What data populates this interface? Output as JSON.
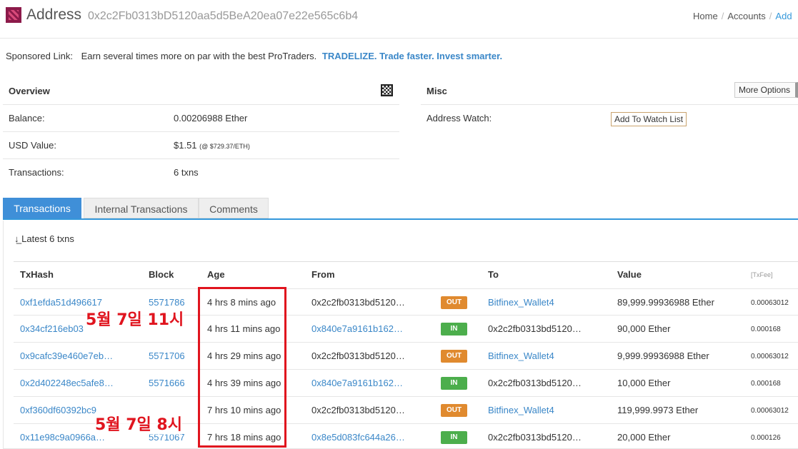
{
  "header": {
    "title": "Address",
    "address": "0x2c2Fb0313bD5120aa5d5BeA20ea07e22e565c6b4",
    "breadcrumb": [
      "Home",
      "Accounts",
      "Add"
    ]
  },
  "sponsored": {
    "label": "Sponsored Link:",
    "message": "Earn several times more on par with the best ProTraders.",
    "link_text": "TRADELIZE. Trade faster. Invest smarter."
  },
  "overview": {
    "title": "Overview",
    "balance_label": "Balance:",
    "balance_value": "0.00206988 Ether",
    "usd_label": "USD Value:",
    "usd_value": "$1.51",
    "usd_rate": "(@ $729.37/ETH)",
    "tx_label": "Transactions:",
    "tx_value": "6 txns"
  },
  "misc": {
    "title": "Misc",
    "more_options": "More Options",
    "watch_label": "Address Watch:",
    "watch_button": "Add To Watch List"
  },
  "tabs": [
    "Transactions",
    "Internal Transactions",
    "Comments"
  ],
  "latest_label": "Latest 6 txns",
  "latest_icon": "sort-desc-icon",
  "columns": [
    "TxHash",
    "Block",
    "Age",
    "From",
    "To",
    "Value",
    "[TxFee]"
  ],
  "rows": [
    {
      "hash": "0xf1efda51d496617",
      "block": "5571786",
      "age": "4 hrs 8 mins ago",
      "from": "0x2c2fb0313bd5120…",
      "dir": "OUT",
      "to": "Bitfinex_Wallet4",
      "value": "89,999.99936988 Ether",
      "fee": "0.00063012"
    },
    {
      "hash": "0x34cf216eb03",
      "block": "",
      "age": "4 hrs 11 mins ago",
      "from": "0x840e7a9161b162…",
      "dir": "IN",
      "to": "0x2c2fb0313bd5120…",
      "value": "90,000 Ether",
      "fee": "0.000168"
    },
    {
      "hash": "0x9cafc39e460e7eb…",
      "block": "5571706",
      "age": "4 hrs 29 mins ago",
      "from": "0x2c2fb0313bd5120…",
      "dir": "OUT",
      "to": "Bitfinex_Wallet4",
      "value": "9,999.99936988 Ether",
      "fee": "0.00063012"
    },
    {
      "hash": "0x2d402248ec5afe8…",
      "block": "5571666",
      "age": "4 hrs 39 mins ago",
      "from": "0x840e7a9161b162…",
      "dir": "IN",
      "to": "0x2c2fb0313bd5120…",
      "value": "10,000 Ether",
      "fee": "0.000168"
    },
    {
      "hash": "0xf360df60392bc9",
      "block": "",
      "age": "7 hrs 10 mins ago",
      "from": "0x2c2fb0313bd5120…",
      "dir": "OUT",
      "to": "Bitfinex_Wallet4",
      "value": "119,999.9973 Ether",
      "fee": "0.00063012"
    },
    {
      "hash": "0x11e98c9a0966a…",
      "block": "5571067",
      "age": "7 hrs 18 mins ago",
      "from": "0x8e5d083fc644a26…",
      "dir": "IN",
      "to": "0x2c2fb0313bd5120…",
      "value": "20,000 Ether",
      "fee": "0.000126"
    }
  ],
  "annotations": [
    "5월 7일 11시",
    "5월 7일 8시"
  ],
  "colors": {
    "annotation": "#e0141e",
    "out_badge": "#e08a2f",
    "in_badge": "#4cae4c",
    "link": "#3a87c8",
    "tab_active": "#3f8fd8"
  }
}
